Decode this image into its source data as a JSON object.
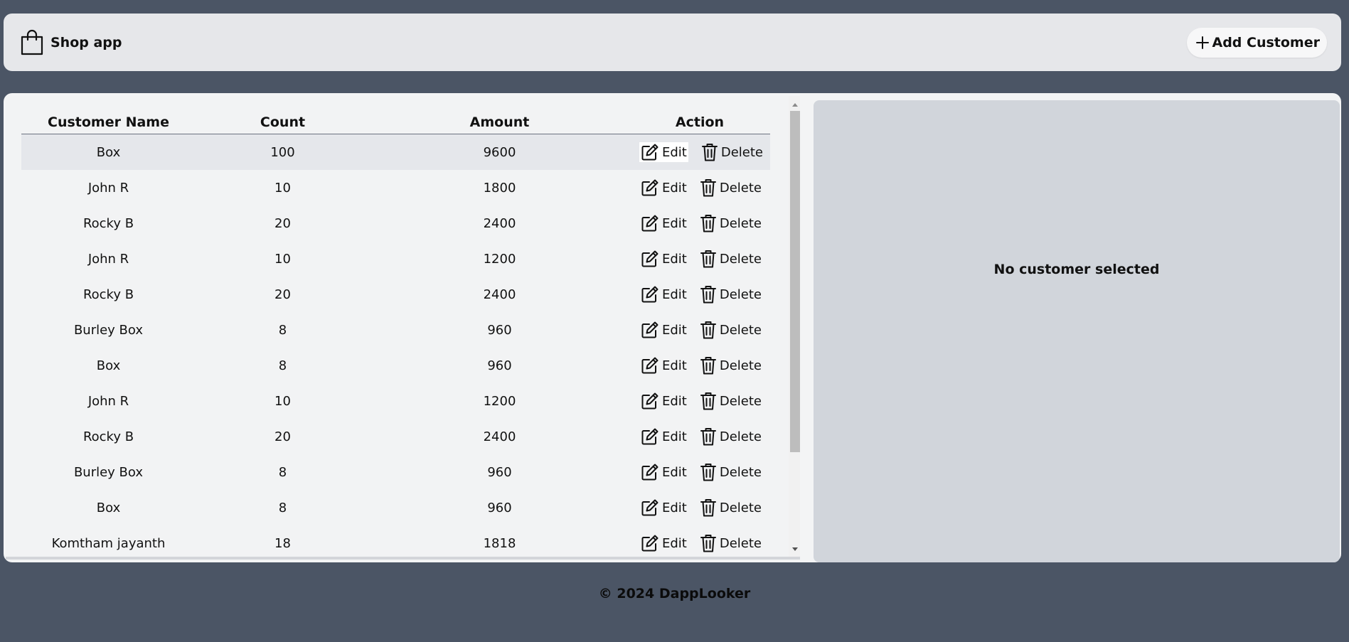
{
  "header": {
    "title": "Shop app",
    "add_button_label": "Add Customer",
    "brand_icon": "shopping-bag-icon",
    "add_icon": "plus-icon"
  },
  "table": {
    "columns": [
      "Customer Name",
      "Count",
      "Amount",
      "Action"
    ],
    "edit_label": "Edit",
    "delete_label": "Delete",
    "rows": [
      {
        "name": "Box",
        "count": "100",
        "amount": "9600"
      },
      {
        "name": "John R",
        "count": "10",
        "amount": "1800"
      },
      {
        "name": "Rocky B",
        "count": "20",
        "amount": "2400"
      },
      {
        "name": "John R",
        "count": "10",
        "amount": "1200"
      },
      {
        "name": "Rocky B",
        "count": "20",
        "amount": "2400"
      },
      {
        "name": "Burley Box",
        "count": "8",
        "amount": "960"
      },
      {
        "name": "Box",
        "count": "8",
        "amount": "960"
      },
      {
        "name": "John R",
        "count": "10",
        "amount": "1200"
      },
      {
        "name": "Rocky B",
        "count": "20",
        "amount": "2400"
      },
      {
        "name": "Burley Box",
        "count": "8",
        "amount": "960"
      },
      {
        "name": "Box",
        "count": "8",
        "amount": "960"
      },
      {
        "name": "Komtham jayanth",
        "count": "18",
        "amount": "1818"
      }
    ]
  },
  "detail": {
    "empty_message": "No customer selected"
  },
  "footer": {
    "text": "© 2024 DappLooker"
  },
  "colors": {
    "page_bg": "#4b5565",
    "panel_bg": "#e6e7ea",
    "detail_bg": "#d1d5db",
    "selected_row_bg": "#e5e7eb"
  }
}
